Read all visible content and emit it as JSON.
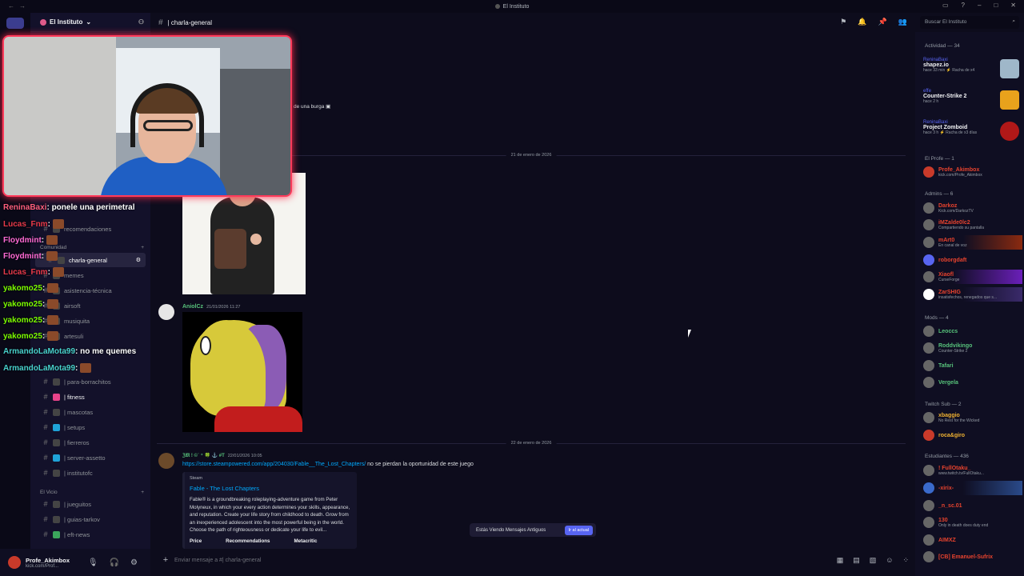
{
  "window": {
    "title": "El Instituto"
  },
  "server": {
    "name": "El Instituto"
  },
  "channel": {
    "name": "| charla-general"
  },
  "search": {
    "placeholder": "Buscar El Instituto"
  },
  "sidebar": {
    "categories": [
      {
        "label": "Comunidad"
      },
      {
        "label": "El Vicio"
      }
    ],
    "channels": [
      {
        "label": "recomendaciones"
      },
      {
        "label": "charla-general"
      },
      {
        "label": "memes"
      },
      {
        "label": "asistencia-técnica"
      },
      {
        "label": "airsoft"
      },
      {
        "label": "musiquita"
      },
      {
        "label": "artesuli"
      },
      {
        "label": "| para-borrachitos"
      },
      {
        "label": "| fitness"
      },
      {
        "label": "| mascotas"
      },
      {
        "label": "| setups"
      },
      {
        "label": "| fierreros"
      },
      {
        "label": "| server-assetto"
      },
      {
        "label": "| institutofc"
      },
      {
        "label": "| jueguitos"
      },
      {
        "label": "| guias-tarkov"
      },
      {
        "label": "| eft-news"
      }
    ]
  },
  "user": {
    "name": "Profe_Akimbox",
    "status": "kick.com/Prof..."
  },
  "messages": {
    "snippet": "de una burga",
    "date1": "21 de enero de 2026",
    "date2": "22 de enero de 2026",
    "author2": "AniolCz",
    "time2": "21/01/2026 11:27",
    "author3": "ℨ𝔐 ! ©ʿ ⁺ 🍀 ⚓ #T",
    "time3": "22/01/2026 10:05",
    "link": "https://store.steampowered.com/app/204030/Fable__The_Lost_Chapters/",
    "link_text": " no se pierdan la oportunidad de este juego",
    "embed": {
      "provider": "Steam",
      "title": "Fable - The Lost Chapters",
      "desc": "Fable® is a groundbreaking roleplaying-adventure game from Peter Molyneux, in which your every action determines your skills, appearance, and reputation. Create your life story from childhood to death. Grow from an inexperienced adolescent into the most powerful being in the world. Choose the path of righteousness or dedicate your life to evil...",
      "field1": "Price",
      "field2": "Recommendations",
      "field3": "Metacritic"
    }
  },
  "old_notice": {
    "text": "Estás Viendo Mensajes Antiguos",
    "button": "Ir al actual"
  },
  "composer": {
    "placeholder": "Enviar mensaje a #| charla-general"
  },
  "members": {
    "activity_header": "Actividad — 34",
    "activities": [
      {
        "user": "ReninaBaxi",
        "game": "shapez.io",
        "time": "hace 33 min  ⚡ Racha de x4"
      },
      {
        "user": "effe",
        "game": "Counter-Strike 2",
        "time": "hace 2 h"
      },
      {
        "user": "ReninaBaxi",
        "game": "Project Zomboid",
        "time": "hace 3 h  ⚡ Racha de x3 días"
      }
    ],
    "sections": [
      {
        "label": "El Profe — 1"
      },
      {
        "label": "Admins — 6"
      },
      {
        "label": "Mods — 4"
      },
      {
        "label": "Twitch Sub — 2"
      },
      {
        "label": "Estudiantes — 436"
      }
    ],
    "list": [
      {
        "name": "Profe_Akimbox",
        "status": "kick.com/Profe_Akimbox",
        "color": "#e8432e"
      },
      {
        "name": "Darkoz",
        "status": "Kick.com/DarkozTV",
        "color": "#e8432e"
      },
      {
        "name": "iMZalde0lc2",
        "status": "Compartiendo su pantalla",
        "color": "#e8432e"
      },
      {
        "name": "mArt0",
        "status": "En canal de voz",
        "color": "#e8432e"
      },
      {
        "name": "roborgdaft",
        "status": "",
        "color": "#e8432e"
      },
      {
        "name": "Xiaofl",
        "status": "CurseForge",
        "color": "#e8432e"
      },
      {
        "name": "ZarSHIG",
        "status": "insatisfechos, renegados que s...",
        "color": "#e8432e"
      },
      {
        "name": "Leoccs",
        "status": "",
        "color": "#57c27b"
      },
      {
        "name": "Roddvikingo",
        "status": "Counter-Strike 2",
        "color": "#57c27b"
      },
      {
        "name": "Tafari",
        "status": "",
        "color": "#57c27b"
      },
      {
        "name": "Vergela",
        "status": "",
        "color": "#57c27b"
      },
      {
        "name": "xbaggio",
        "status": "No Rest for the Wicked",
        "color": "#f0b232"
      },
      {
        "name": "roca&giro",
        "status": "",
        "color": "#f0b232"
      },
      {
        "name": "! FullOtaku_",
        "status": "www.twitch.tv/FullOtaku...",
        "color": "#e8432e"
      },
      {
        "name": "-xirix-",
        "status": "",
        "color": "#e8432e"
      },
      {
        "name": "_n_sc.01",
        "status": "",
        "color": "#e8432e"
      },
      {
        "name": "130",
        "status": "Only in death does duty end",
        "color": "#e8432e"
      },
      {
        "name": "AIMXZ",
        "status": "",
        "color": "#e8432e"
      },
      {
        "name": "[CB] Emanuel-Sufrix",
        "status": "",
        "color": "#e8432e"
      }
    ]
  },
  "stream_chat": [
    {
      "user": "ReninaBaxi",
      "msg": ": ponele una perimetral",
      "color": "#ff5f7e"
    },
    {
      "user": "Lucas_Fnm",
      "msg": ":",
      "color": "#e83a4a"
    },
    {
      "user": "Floydmint",
      "msg": ":",
      "color": "#ff6ad5"
    },
    {
      "user": "Floydmint",
      "msg": ":",
      "color": "#ff6ad5"
    },
    {
      "user": "Lucas_Fnm",
      "msg": ":",
      "color": "#e83a4a"
    },
    {
      "user": "yakomo25",
      "msg": ":",
      "color": "#7cfc00"
    },
    {
      "user": "yakomo25",
      "msg": ":",
      "color": "#7cfc00"
    },
    {
      "user": "yakomo25",
      "msg": ":",
      "color": "#7cfc00"
    },
    {
      "user": "yakomo25",
      "msg": ":",
      "color": "#7cfc00"
    },
    {
      "user": "ArmandoLaMota99",
      "msg": ": no me quemes",
      "color": "#48d1cc"
    },
    {
      "user": "ArmandoLaMota99",
      "msg": ":",
      "color": "#48d1cc"
    }
  ]
}
